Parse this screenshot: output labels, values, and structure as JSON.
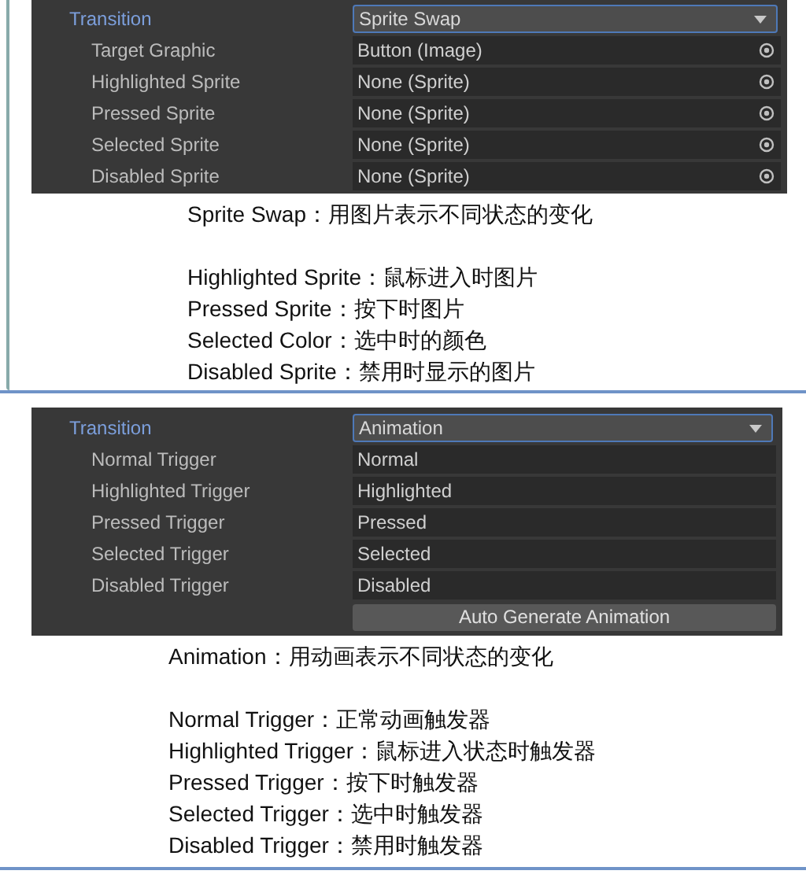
{
  "sections": [
    {
      "panel": {
        "transition_label": "Transition",
        "dropdown": "Sprite Swap",
        "rows": [
          {
            "label": "Target Graphic",
            "value": "Button (Image)",
            "kind": "object"
          },
          {
            "label": "Highlighted Sprite",
            "value": "None (Sprite)",
            "kind": "object"
          },
          {
            "label": "Pressed Sprite",
            "value": "None (Sprite)",
            "kind": "object"
          },
          {
            "label": "Selected Sprite",
            "value": "None (Sprite)",
            "kind": "object"
          },
          {
            "label": "Disabled Sprite",
            "value": "None (Sprite)",
            "kind": "object"
          }
        ]
      },
      "notes": {
        "heading": "Sprite Swap：用图片表示不同状态的变化",
        "lines": [
          "Highlighted Sprite：鼠标进入时图片",
          "Pressed Sprite：按下时图片",
          "Selected Color：选中时的颜色",
          "Disabled Sprite：禁用时显示的图片"
        ]
      }
    },
    {
      "panel": {
        "transition_label": "Transition",
        "dropdown": "Animation",
        "rows": [
          {
            "label": "Normal Trigger",
            "value": "Normal",
            "kind": "text"
          },
          {
            "label": "Highlighted Trigger",
            "value": "Highlighted",
            "kind": "text"
          },
          {
            "label": "Pressed Trigger",
            "value": "Pressed",
            "kind": "text"
          },
          {
            "label": "Selected Trigger",
            "value": "Selected",
            "kind": "text"
          },
          {
            "label": "Disabled Trigger",
            "value": "Disabled",
            "kind": "text"
          }
        ],
        "button": "Auto Generate Animation"
      },
      "notes": {
        "heading": "Animation：用动画表示不同状态的变化",
        "lines": [
          "Normal Trigger：正常动画触发器",
          "Highlighted Trigger：鼠标进入状态时触发器",
          "Pressed Trigger：按下时触发器",
          "Selected Trigger：选中时触发器",
          "Disabled Trigger：禁用时触发器"
        ]
      }
    }
  ]
}
